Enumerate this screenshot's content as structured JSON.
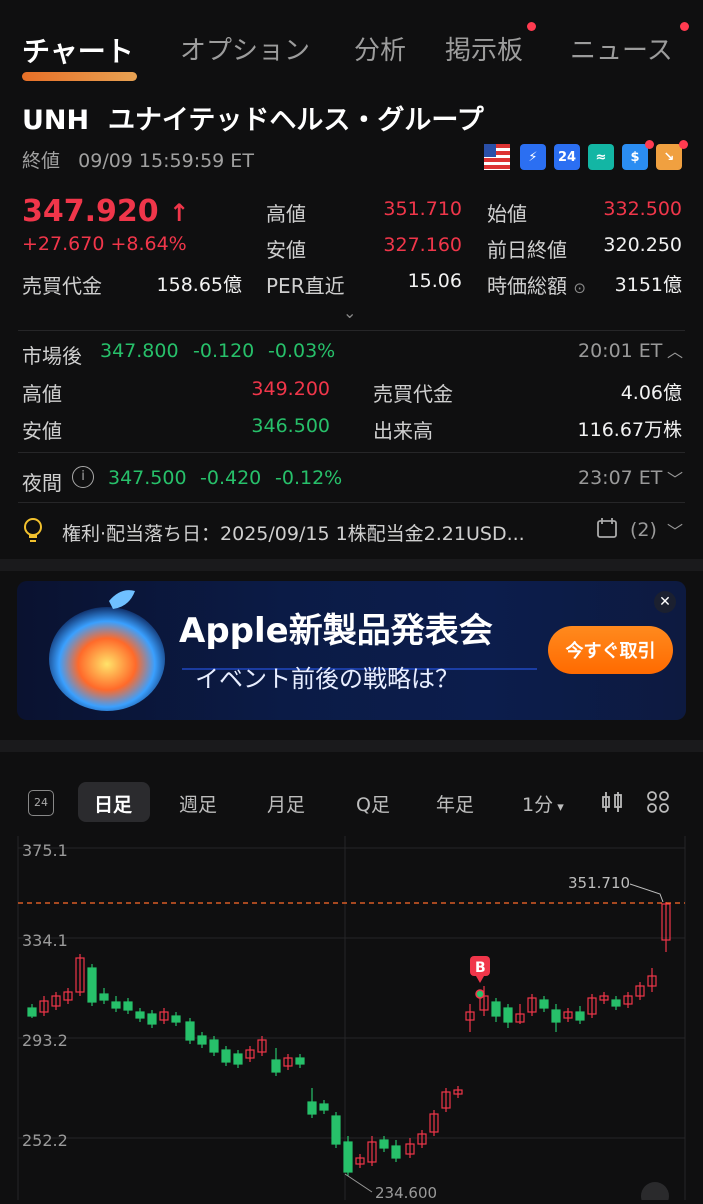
{
  "tabs": [
    {
      "label": "チャート",
      "active": true
    },
    {
      "label": "オプション"
    },
    {
      "label": "分析",
      "dot": true
    },
    {
      "label": "掲示板",
      "dot": true
    },
    {
      "label": "ニュース",
      "dot": true
    }
  ],
  "stock": {
    "ticker": "UNH",
    "name": "ユナイテッドヘルス・グループ",
    "status": "終値",
    "datetime": "09/09 15:59:59 ET",
    "price": "347.920",
    "arrow": "↑",
    "change": "+27.670 +8.64%"
  },
  "quote": {
    "high_label": "高値",
    "high": "351.710",
    "open_label": "始値",
    "open": "332.500",
    "low_label": "安値",
    "low": "327.160",
    "prev_label": "前日終値",
    "prev": "320.250",
    "turnover_label": "売買代金",
    "turnover": "158.65億",
    "per_label": "PER直近",
    "per": "15.06",
    "mcap_label": "時価総額",
    "mcap": "3151億"
  },
  "after_hours": {
    "label": "市場後",
    "price": "347.800",
    "change": "-0.120",
    "pct": "-0.03%",
    "time": "20:01 ET",
    "high_label": "高値",
    "high": "349.200",
    "low_label": "安値",
    "low": "346.500",
    "turnover_label": "売買代金",
    "turnover": "4.06億",
    "volume_label": "出来高",
    "volume": "116.67万株"
  },
  "overnight": {
    "label": "夜間",
    "price": "347.500",
    "change": "-0.420",
    "pct": "-0.12%",
    "time": "23:07 ET"
  },
  "dividend": {
    "text": "権利·配当落ち日：2025/09/15 1株配当金2.21USD...",
    "count": "(2)"
  },
  "banner": {
    "title": "Apple新製品発表会",
    "subtitle": "イベント前後の戦略は？",
    "cta": "今すぐ取引"
  },
  "chart_tabs": {
    "items": [
      "日足",
      "週足",
      "月足",
      "Q足",
      "年足"
    ],
    "interval": "1分"
  },
  "chart_data": {
    "type": "candlestick",
    "y_ticks": [
      "375.1",
      "334.1",
      "293.2",
      "252.2"
    ],
    "high_marker": "351.710",
    "low_marker": "234.600",
    "buy_marker": "B",
    "colors": {
      "up": "#f0364a",
      "down": "#27c06a"
    }
  }
}
